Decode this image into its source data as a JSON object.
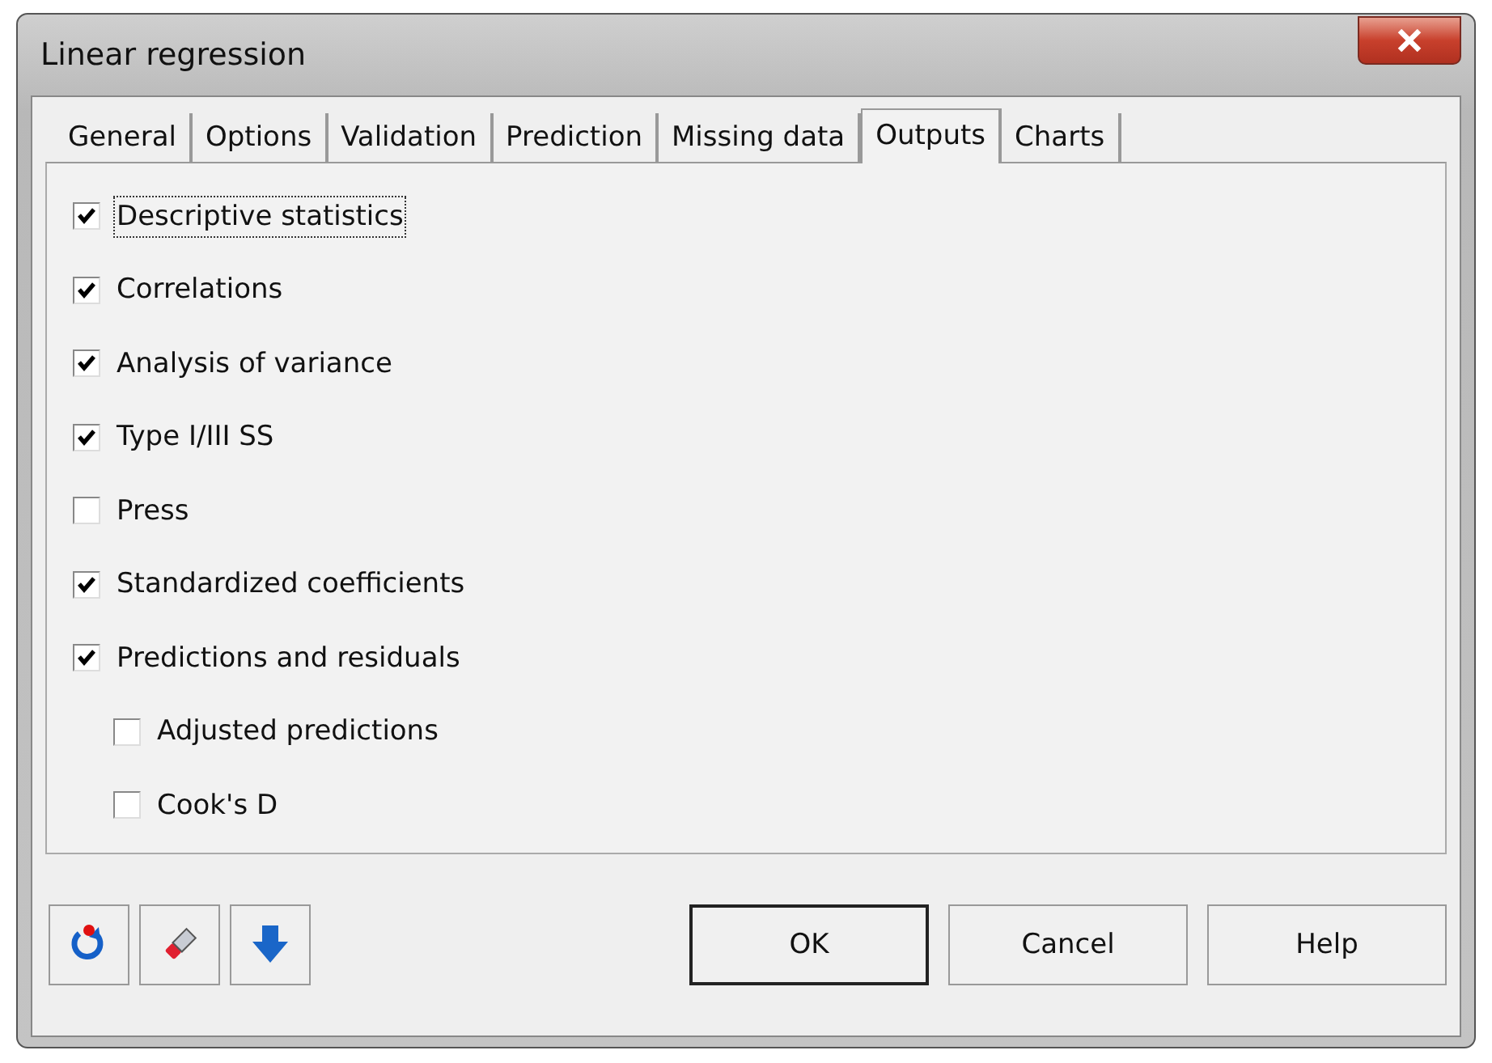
{
  "window": {
    "title": "Linear regression"
  },
  "tabs": [
    {
      "label": "General",
      "selected": false
    },
    {
      "label": "Options",
      "selected": false
    },
    {
      "label": "Validation",
      "selected": false
    },
    {
      "label": "Prediction",
      "selected": false
    },
    {
      "label": "Missing data",
      "selected": false
    },
    {
      "label": "Outputs",
      "selected": true
    },
    {
      "label": "Charts",
      "selected": false
    }
  ],
  "options": [
    {
      "label": "Descriptive statistics",
      "checked": true,
      "focused": true
    },
    {
      "label": "Correlations",
      "checked": true,
      "focused": false
    },
    {
      "label": "Analysis of variance",
      "checked": true,
      "focused": false
    },
    {
      "label": "Type I/III SS",
      "checked": true,
      "focused": false
    },
    {
      "label": "Press",
      "checked": false,
      "focused": false
    },
    {
      "label": "Standardized coefficients",
      "checked": true,
      "focused": false
    },
    {
      "label": "Predictions and residuals",
      "checked": true,
      "focused": false,
      "children": [
        {
          "label": "Adjusted predictions",
          "checked": false,
          "focused": false
        },
        {
          "label": "Cook's D",
          "checked": false,
          "focused": false
        }
      ]
    }
  ],
  "tool_buttons": [
    {
      "kind": "reset"
    },
    {
      "kind": "eraser"
    },
    {
      "kind": "down"
    }
  ],
  "buttons": [
    {
      "label": "OK",
      "default": true
    },
    {
      "label": "Cancel",
      "default": false
    },
    {
      "label": "Help",
      "default": false
    }
  ]
}
